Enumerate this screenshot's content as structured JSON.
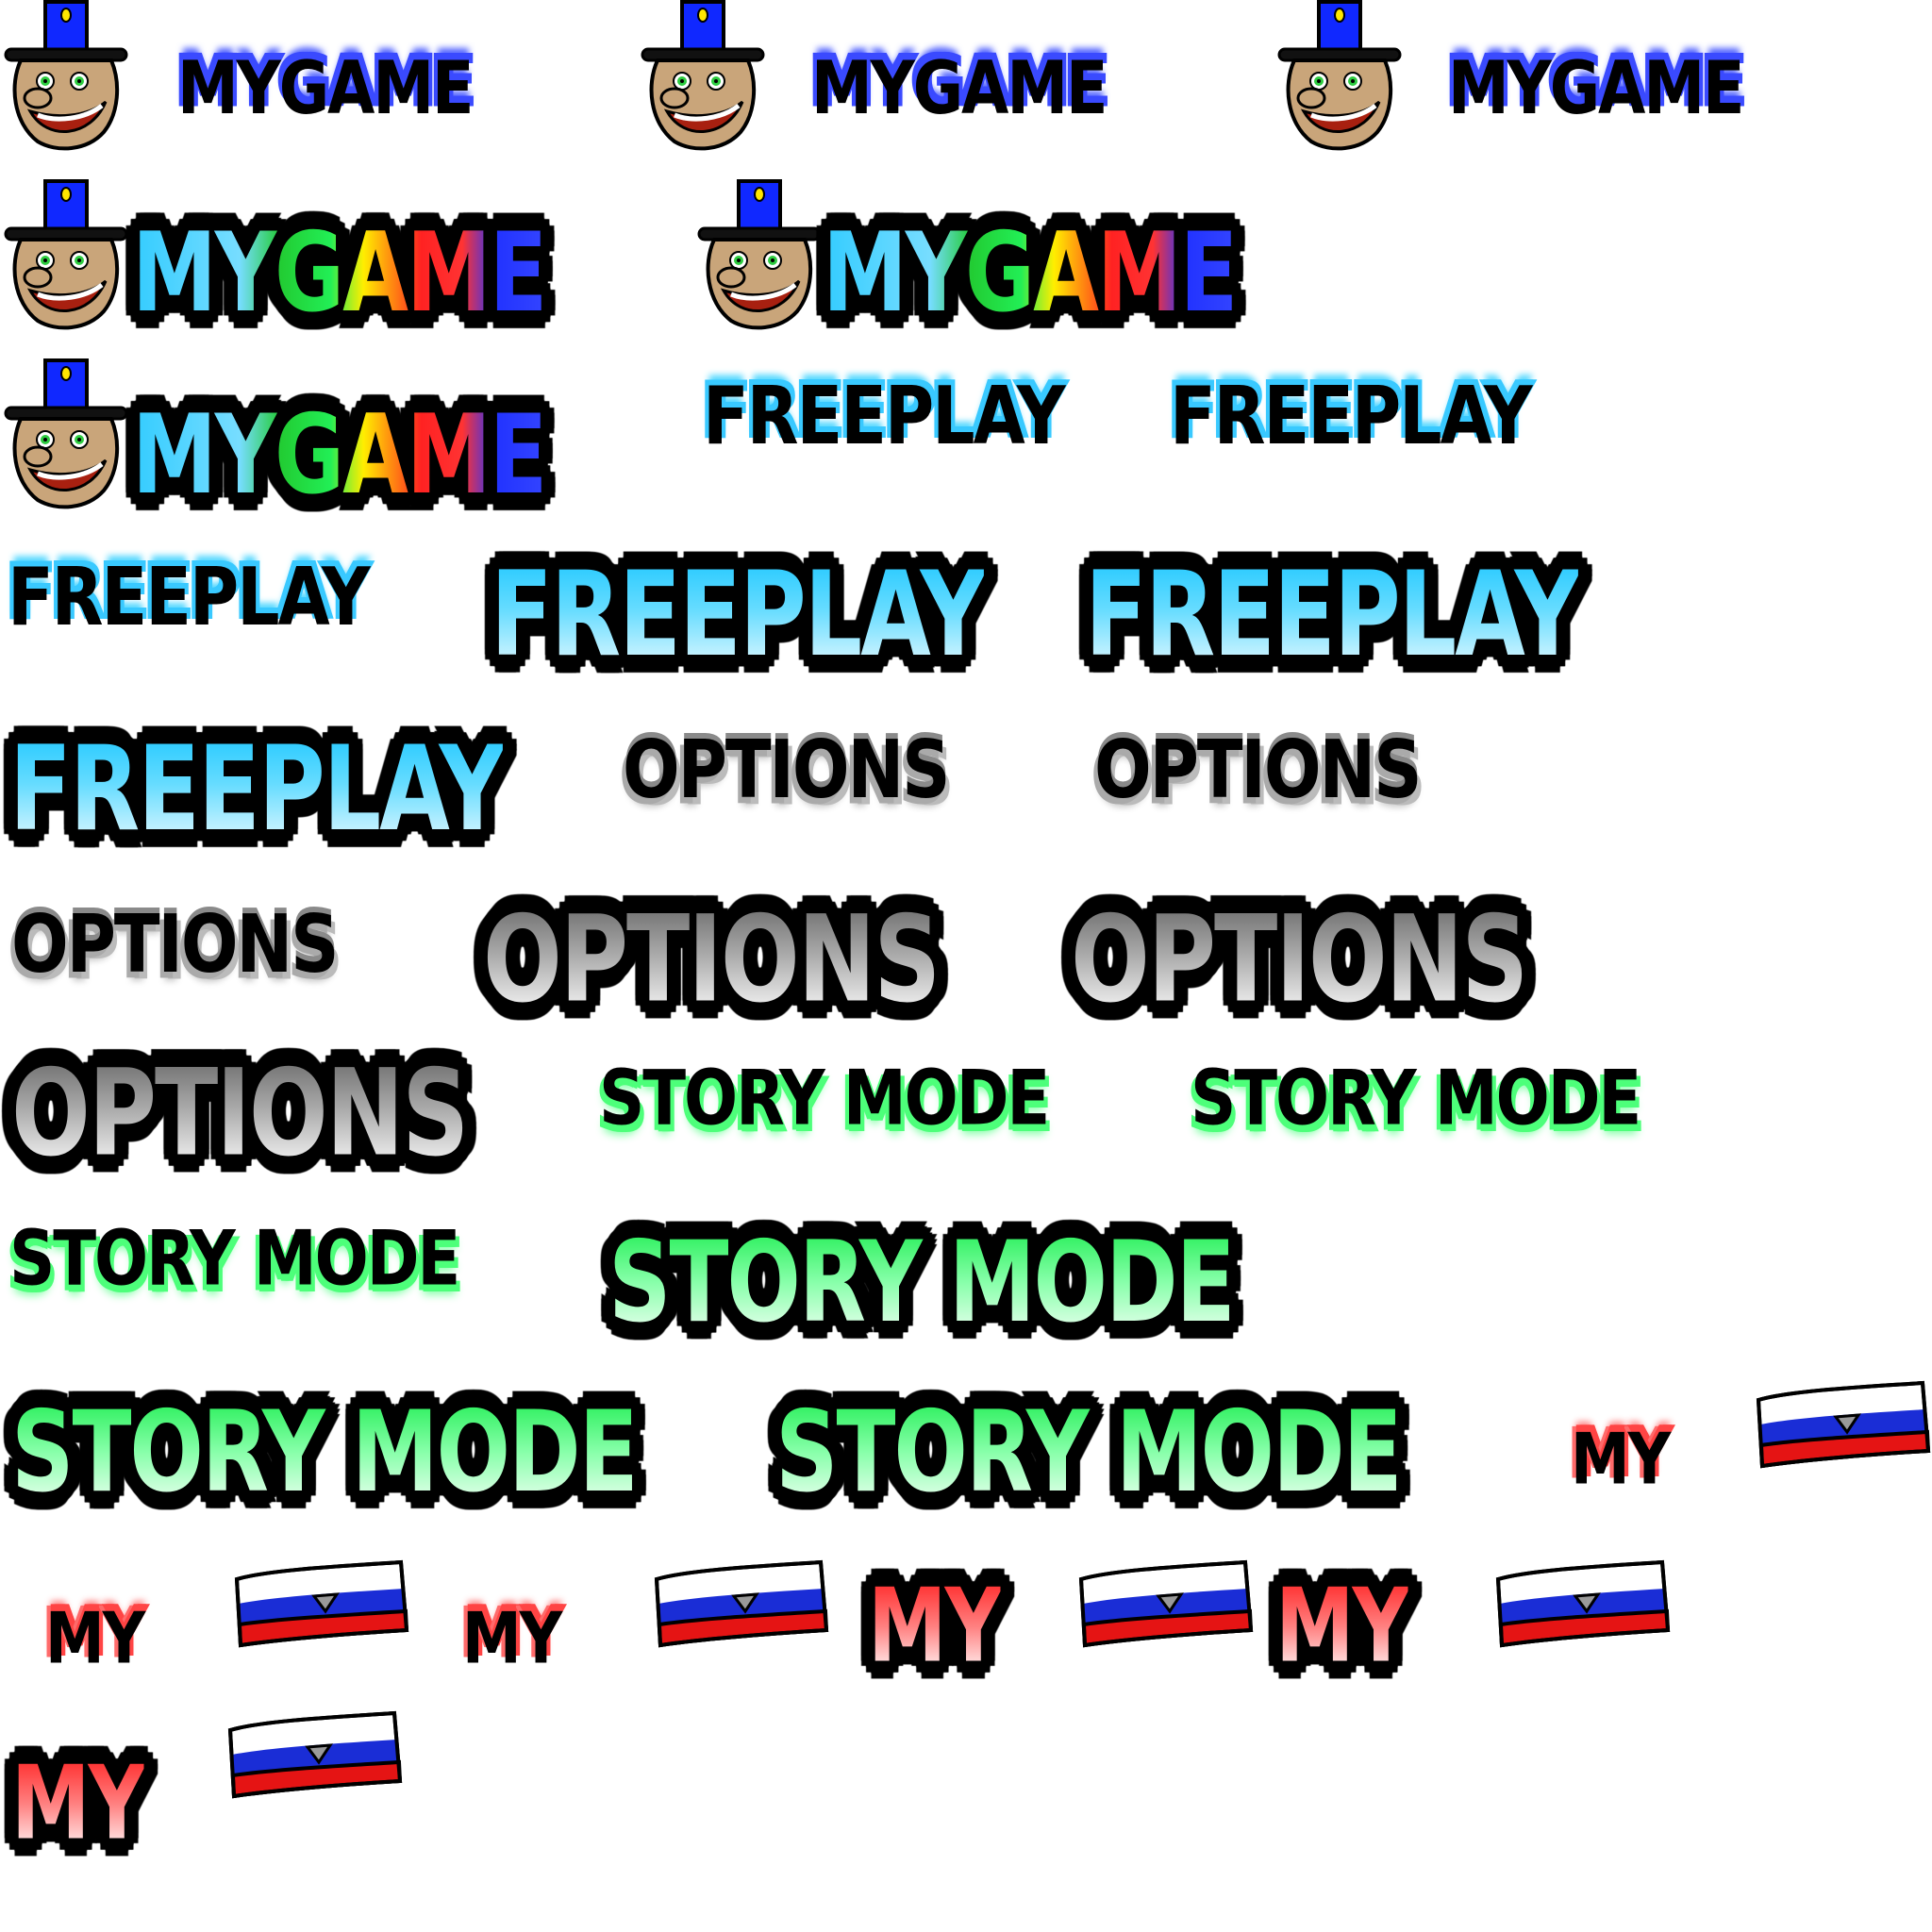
{
  "atlas": {
    "title_text": "MYGAME",
    "freeplay_text": "FREEPLAY",
    "options_text": "OPTIONS",
    "storymode_text": "STORY MODE",
    "my_text": "MY"
  },
  "colors": {
    "mascot_hat": "#1028ff",
    "mascot_skin": "#c9a57a",
    "mascot_mouth": "#a82010",
    "mascot_eye": "#2ecc40",
    "flag_white": "#ffffff",
    "flag_blue": "#1a2dd6",
    "flag_red": "#e51414",
    "outline": "#000000"
  },
  "icons": [
    "mascot-face-icon",
    "flag-icon"
  ]
}
